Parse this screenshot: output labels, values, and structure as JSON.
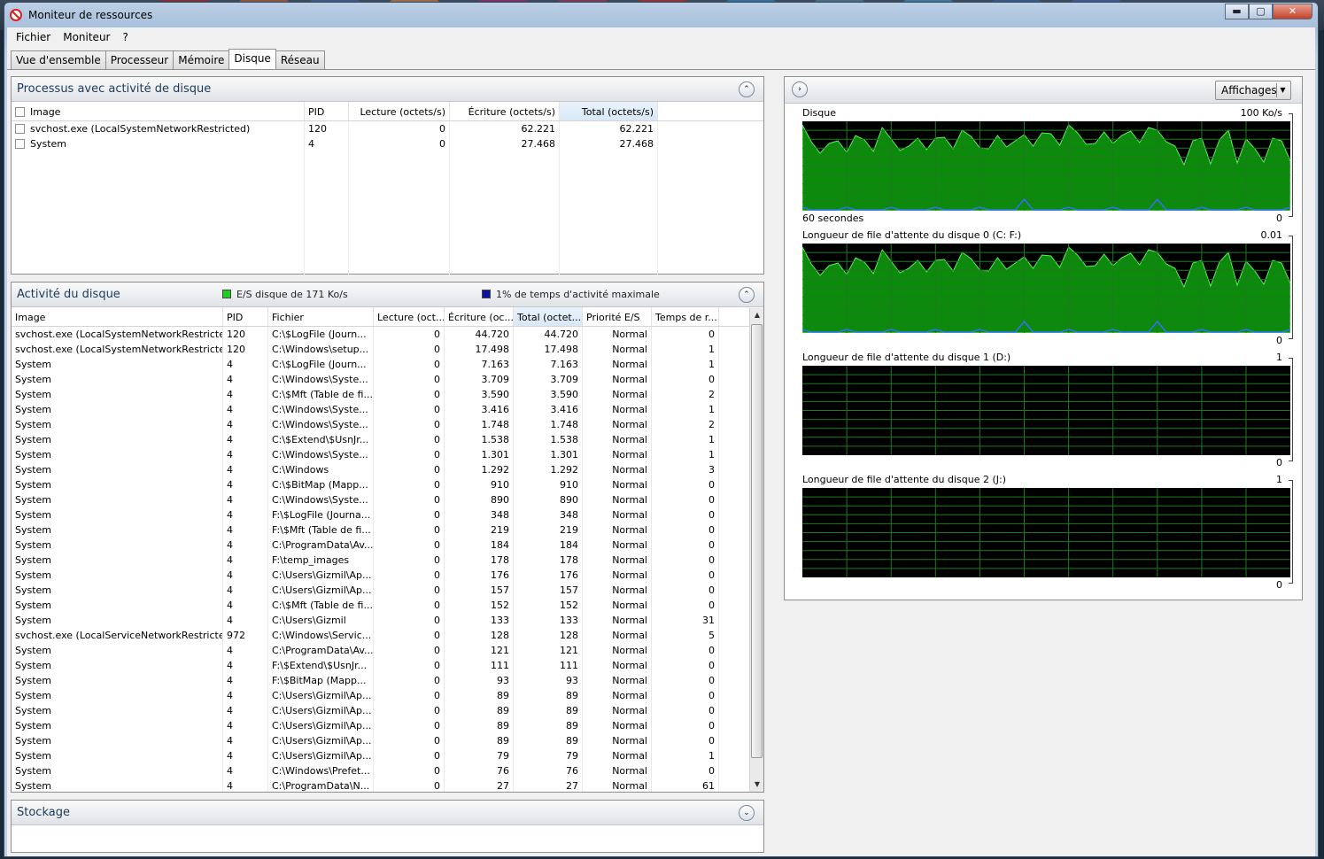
{
  "window": {
    "title": "Moniteur de ressources",
    "min": "▬",
    "max": "▢",
    "close": "✕"
  },
  "menu": [
    "Fichier",
    "Moniteur",
    "?"
  ],
  "tabs": [
    "Vue d'ensemble",
    "Processeur",
    "Mémoire",
    "Disque",
    "Réseau"
  ],
  "active_tab": "Disque",
  "processes": {
    "title": "Processus avec activité de disque",
    "columns": [
      "Image",
      "PID",
      "Lecture (octets/s)",
      "Écriture (octets/s)",
      "Total (octets/s)"
    ],
    "rows": [
      [
        "svchost.exe (LocalSystemNetworkRestricted)",
        "120",
        "0",
        "62.221",
        "62.221"
      ],
      [
        "System",
        "4",
        "0",
        "27.468",
        "27.468"
      ]
    ]
  },
  "activity": {
    "title": "Activité du disque",
    "legend_io": "E/S disque de 171 Ko/s",
    "legend_busy": "1% de temps d'activité maximale",
    "io_color": "#22cc22",
    "busy_color": "#1010a0",
    "columns": [
      "Image",
      "PID",
      "Fichier",
      "Lecture (oct...",
      "Écriture (oc...",
      "Total (octet...",
      "Priorité E/S",
      "Temps de r..."
    ],
    "rows": [
      [
        "svchost.exe (LocalSystemNetworkRestricted)",
        "120",
        "C:\\$LogFile (Journ...",
        "0",
        "44.720",
        "44.720",
        "Normal",
        "0"
      ],
      [
        "svchost.exe (LocalSystemNetworkRestricted)",
        "120",
        "C:\\Windows\\setup...",
        "0",
        "17.498",
        "17.498",
        "Normal",
        "1"
      ],
      [
        "System",
        "4",
        "C:\\$LogFile (Journ...",
        "0",
        "7.163",
        "7.163",
        "Normal",
        "1"
      ],
      [
        "System",
        "4",
        "C:\\Windows\\Syste...",
        "0",
        "3.709",
        "3.709",
        "Normal",
        "0"
      ],
      [
        "System",
        "4",
        "C:\\$Mft (Table de fi...",
        "0",
        "3.590",
        "3.590",
        "Normal",
        "2"
      ],
      [
        "System",
        "4",
        "C:\\Windows\\Syste...",
        "0",
        "3.416",
        "3.416",
        "Normal",
        "1"
      ],
      [
        "System",
        "4",
        "C:\\Windows\\Syste...",
        "0",
        "1.748",
        "1.748",
        "Normal",
        "2"
      ],
      [
        "System",
        "4",
        "C:\\$Extend\\$UsnJr...",
        "0",
        "1.538",
        "1.538",
        "Normal",
        "1"
      ],
      [
        "System",
        "4",
        "C:\\Windows\\Syste...",
        "0",
        "1.301",
        "1.301",
        "Normal",
        "1"
      ],
      [
        "System",
        "4",
        "C:\\Windows",
        "0",
        "1.292",
        "1.292",
        "Normal",
        "3"
      ],
      [
        "System",
        "4",
        "C:\\$BitMap (Mapp...",
        "0",
        "910",
        "910",
        "Normal",
        "0"
      ],
      [
        "System",
        "4",
        "C:\\Windows\\Syste...",
        "0",
        "890",
        "890",
        "Normal",
        "0"
      ],
      [
        "System",
        "4",
        "F:\\$LogFile (Journa...",
        "0",
        "348",
        "348",
        "Normal",
        "0"
      ],
      [
        "System",
        "4",
        "F:\\$Mft (Table de fi...",
        "0",
        "219",
        "219",
        "Normal",
        "0"
      ],
      [
        "System",
        "4",
        "C:\\ProgramData\\Av...",
        "0",
        "184",
        "184",
        "Normal",
        "0"
      ],
      [
        "System",
        "4",
        "F:\\temp_images",
        "0",
        "178",
        "178",
        "Normal",
        "0"
      ],
      [
        "System",
        "4",
        "C:\\Users\\Gizmil\\Ap...",
        "0",
        "176",
        "176",
        "Normal",
        "0"
      ],
      [
        "System",
        "4",
        "C:\\Users\\Gizmil\\Ap...",
        "0",
        "157",
        "157",
        "Normal",
        "0"
      ],
      [
        "System",
        "4",
        "C:\\$Mft (Table de fi...",
        "0",
        "152",
        "152",
        "Normal",
        "0"
      ],
      [
        "System",
        "4",
        "C:\\Users\\Gizmil",
        "0",
        "133",
        "133",
        "Normal",
        "31"
      ],
      [
        "svchost.exe (LocalServiceNetworkRestricted)",
        "972",
        "C:\\Windows\\Servic...",
        "0",
        "128",
        "128",
        "Normal",
        "5"
      ],
      [
        "System",
        "4",
        "C:\\ProgramData\\Av...",
        "0",
        "121",
        "121",
        "Normal",
        "0"
      ],
      [
        "System",
        "4",
        "F:\\$Extend\\$UsnJr...",
        "0",
        "111",
        "111",
        "Normal",
        "0"
      ],
      [
        "System",
        "4",
        "F:\\$BitMap (Mapp...",
        "0",
        "93",
        "93",
        "Normal",
        "0"
      ],
      [
        "System",
        "4",
        "C:\\Users\\Gizmil\\Ap...",
        "0",
        "89",
        "89",
        "Normal",
        "0"
      ],
      [
        "System",
        "4",
        "C:\\Users\\Gizmil\\Ap...",
        "0",
        "89",
        "89",
        "Normal",
        "0"
      ],
      [
        "System",
        "4",
        "C:\\Users\\Gizmil\\Ap...",
        "0",
        "89",
        "89",
        "Normal",
        "0"
      ],
      [
        "System",
        "4",
        "C:\\Users\\Gizmil\\Ap...",
        "0",
        "89",
        "89",
        "Normal",
        "0"
      ],
      [
        "System",
        "4",
        "C:\\Users\\Gizmil\\Ap...",
        "0",
        "79",
        "79",
        "Normal",
        "1"
      ],
      [
        "System",
        "4",
        "C:\\Windows\\Prefet...",
        "0",
        "76",
        "76",
        "Normal",
        "0"
      ],
      [
        "System",
        "4",
        "C:\\ProgramData\\N...",
        "0",
        "27",
        "27",
        "Normal",
        "61"
      ]
    ]
  },
  "storage": {
    "title": "Stockage"
  },
  "right": {
    "views_button": "Affichages",
    "graphs": [
      {
        "title": "Disque",
        "max": "100 Ko/s",
        "min": "0",
        "footer": "60 secondes",
        "active": true
      },
      {
        "title": "Longueur de file d'attente du disque 0 (C: F:)",
        "max": "0.01",
        "min": "0",
        "active": true
      },
      {
        "title": "Longueur de file d'attente du disque 1 (D:)",
        "max": "1",
        "min": "0",
        "active": false
      },
      {
        "title": "Longueur de file d'attente du disque 2 (J:)",
        "max": "1",
        "min": "0",
        "active": false
      }
    ]
  }
}
